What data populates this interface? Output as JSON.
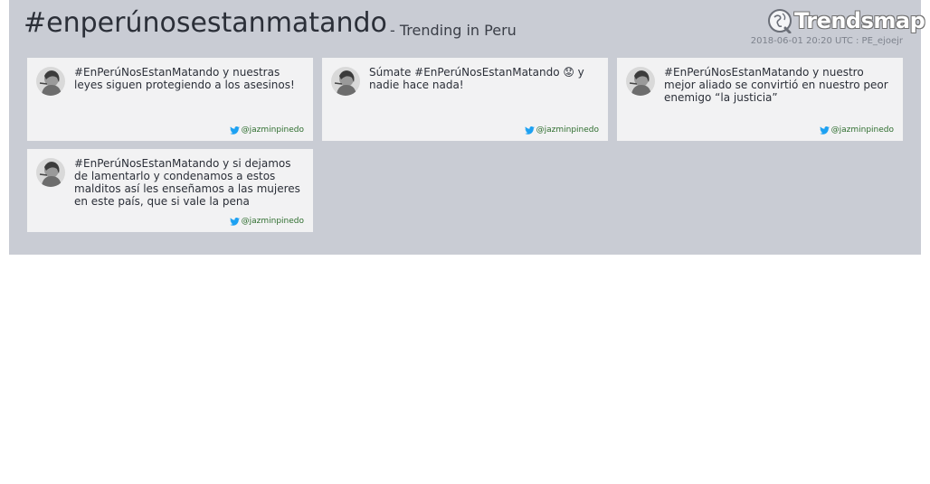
{
  "header": {
    "hashtag": "#enperúnosestanmatando",
    "subtitle": "- Trending in Peru",
    "logo_text": "Trendsmap",
    "meta": "2018-06-01 20:20 UTC : PE_ejoejr"
  },
  "tweets": [
    {
      "text": "#EnPerúNosEstanMatando y nuestras leyes siguen protegiendo a los asesinos!",
      "author": "@jazminpinedo"
    },
    {
      "text": "Súmate #EnPerúNosEstanMatando 😟 y nadie hace nada!",
      "author": "@jazminpinedo"
    },
    {
      "text": "#EnPerúNosEstanMatando y nuestro mejor aliado se convirtió en nuestro peor enemigo “la justicia”",
      "author": "@jazminpinedo"
    },
    {
      "text": "#EnPerúNosEstanMatando y si dejamos de lamentarlo y condenamos a estos malditos así les enseñamos a las mujeres en este país, que si vale la pena",
      "author": "@jazminpinedo"
    }
  ],
  "icons": {
    "logo": "trendsmap-globe-icon",
    "avatar": "avatar",
    "author": "twitter-bird-icon"
  },
  "colors": {
    "panel": "#c9ccd4",
    "card": "#f2f2f3",
    "twitter_blue": "#1da1f2",
    "author_green": "#2f6e2f"
  }
}
